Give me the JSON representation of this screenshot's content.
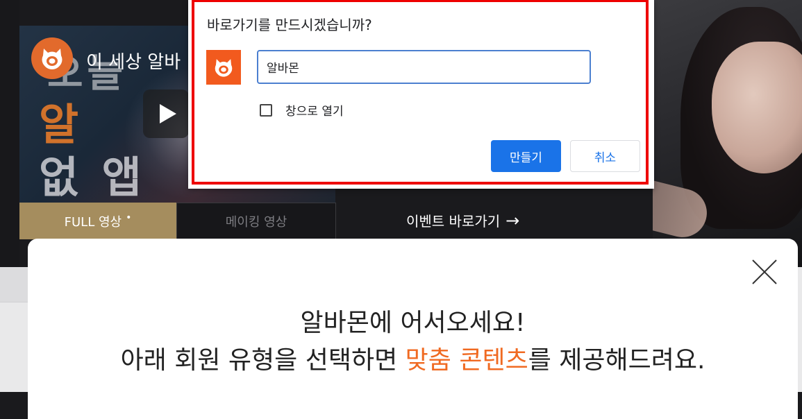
{
  "background": {
    "video": {
      "channel_title": "이 세상 알바",
      "overlay_text_top": "오늘",
      "overlay_text_orange": "알",
      "overlay_text_bottom": "없 앱"
    },
    "tabs": {
      "full_label": "FULL 영상",
      "full_dot": "•",
      "making_label": "메이킹 영상"
    },
    "event_link": {
      "label": "이벤트 바로가기",
      "arrow": "→"
    }
  },
  "welcome": {
    "line1": "알바몬에 어서오세요!",
    "line2_before": "아래 회원 유형을 선택하면 ",
    "line2_highlight": "맞춤 콘텐츠",
    "line2_after": "를 제공해드려요.",
    "highlight_color": "#f06a22"
  },
  "shortcut_dialog": {
    "title": "바로가기를 만드시겠습니까?",
    "name_value": "알바몬",
    "open_as_window_label": "창으로 열기",
    "open_as_window_checked": false,
    "create_button": "만들기",
    "cancel_button": "취소",
    "highlight_border_color": "#ee0000",
    "primary_color": "#1a73e8",
    "app_icon_color": "#f25a1e"
  }
}
